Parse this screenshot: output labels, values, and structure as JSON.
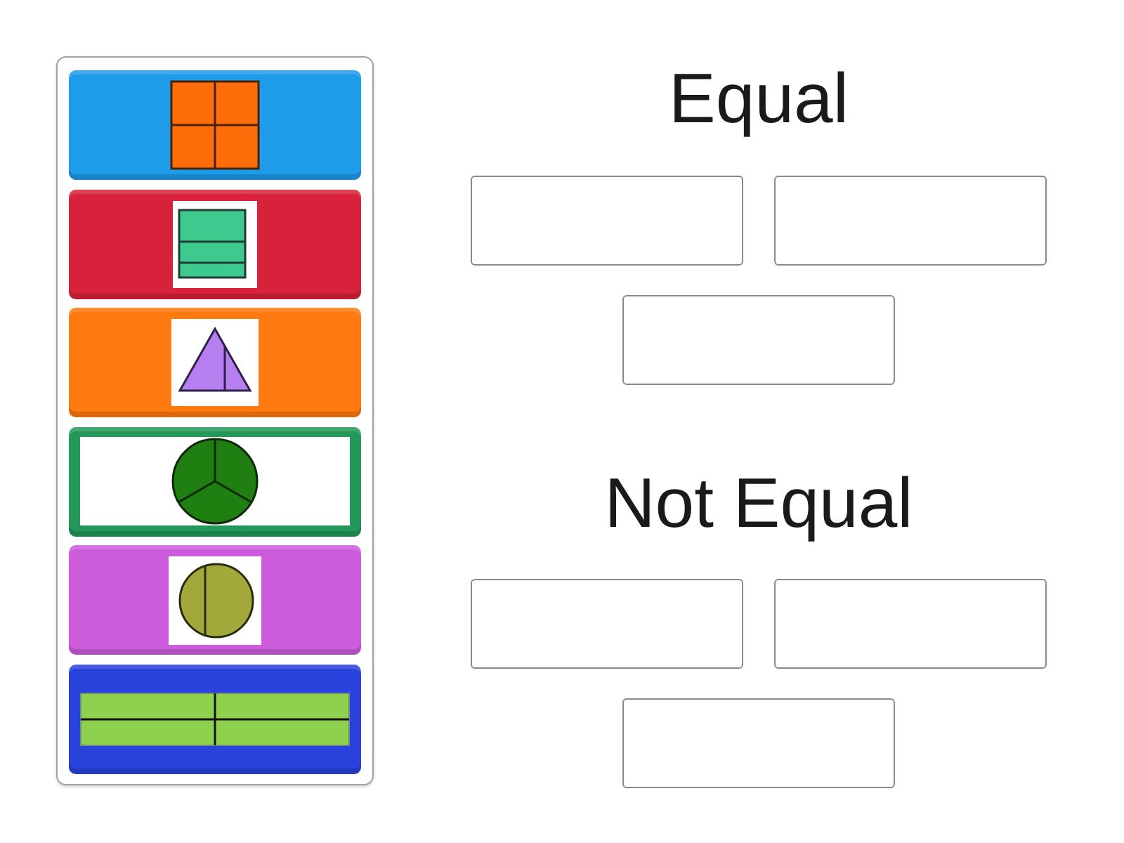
{
  "cards": [
    {
      "color": "#1e9be9",
      "picture": {
        "kind": "square-quarters"
      }
    },
    {
      "color": "#d8223b",
      "picture": {
        "kind": "rectangle-strips"
      }
    },
    {
      "color": "#ff7a10",
      "picture": {
        "kind": "triangle-halves"
      }
    },
    {
      "color": "#23985a",
      "picture": {
        "kind": "circle-thirds"
      }
    },
    {
      "color": "#cc5cdc",
      "picture": {
        "kind": "circle-halves"
      }
    },
    {
      "color": "#2a42dc",
      "picture": {
        "kind": "bar-quarters"
      }
    }
  ],
  "groups": [
    {
      "title": "Equal",
      "answer_boxes": [
        {
          "kind": "empty"
        },
        {
          "kind": "empty"
        },
        {
          "kind": "empty"
        }
      ]
    },
    {
      "title": "Not Equal",
      "answer_boxes": [
        {
          "kind": "empty"
        },
        {
          "kind": "empty"
        },
        {
          "kind": "empty"
        }
      ]
    }
  ]
}
